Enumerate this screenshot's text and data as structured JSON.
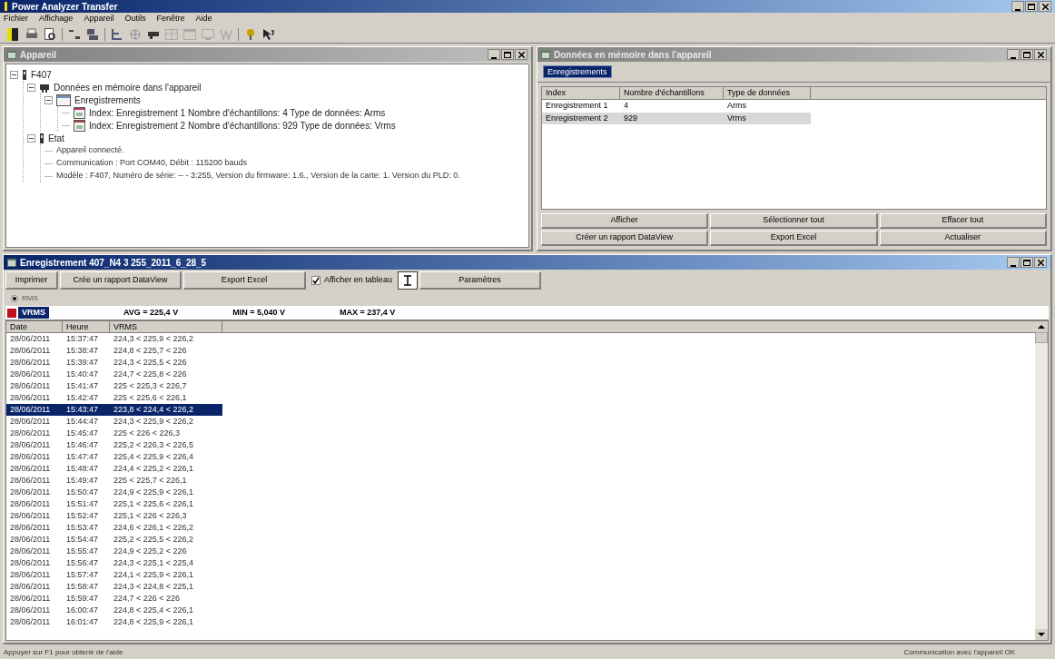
{
  "window": {
    "title": "Power Analyzer Transfer"
  },
  "menu": [
    "Fichier",
    "Affichage",
    "Appareil",
    "Outils",
    "Fenêtre",
    "Aide"
  ],
  "device_pane": {
    "title": "Appareil",
    "tree": [
      {
        "label": "F407",
        "kind": "device",
        "expanded": true,
        "children": [
          {
            "label": "Données en mémoire dans l'appareil",
            "kind": "memory",
            "expanded": true,
            "children": [
              {
                "label": "Enregistrements",
                "kind": "folder",
                "expanded": true,
                "children": [
                  {
                    "label": "Index: Enregistrement 1 Nombre d'échantillons: 4 Type de données: Arms",
                    "kind": "record"
                  },
                  {
                    "label": "Index: Enregistrement 2 Nombre d'échantillons: 929 Type de données: Vrms",
                    "kind": "record"
                  }
                ]
              }
            ]
          },
          {
            "label": "Etat",
            "kind": "device",
            "expanded": true,
            "children": [
              {
                "label": "Appareil connecté.",
                "kind": "info"
              },
              {
                "label": "Communication : Port COM40, Débit : 115200 bauds",
                "kind": "info"
              },
              {
                "label": "Modèle : F407, Numéro de série: -- - 3:255, Version du firmware: 1.6., Version de la carte: 1. Version du PLD: 0.",
                "kind": "info"
              }
            ]
          }
        ]
      }
    ]
  },
  "memory_pane": {
    "title": "Données en mémoire dans l'appareil",
    "tabs": [
      {
        "label": "Enregistrements",
        "selected": true
      }
    ],
    "columns": [
      "Index",
      "Nombre d'échantillons",
      "Type de données"
    ],
    "rows": [
      {
        "cells": [
          "Enregistrement 1",
          "4",
          "Arms"
        ],
        "selected": false
      },
      {
        "cells": [
          "Enregistrement 2",
          "929",
          "Vrms"
        ],
        "selected": true
      }
    ],
    "buttons": [
      "Afficher",
      "Sélectionner tout",
      "Effacer tout",
      "Créer un rapport DataView",
      "Export Excel",
      "Actualiser"
    ]
  },
  "record_pane": {
    "title": "Enregistrement 407_N4 3 255_2011_6_28_5",
    "buttons": [
      "Imprimer",
      "Crée un rapport DataView",
      "Export Excel"
    ],
    "show_table": {
      "label": "Afficher en tableau",
      "checked": true
    },
    "settings_button": "Paramètres",
    "radio": {
      "label": "RMS",
      "selected": true
    },
    "series": {
      "name": "VRMS",
      "color": "#c0101a"
    },
    "stats": [
      "AVG = 225,4 V",
      "MIN = 5,040 V",
      "MAX = 237,4 V"
    ],
    "columns": [
      "Date",
      "Heure",
      "VRMS"
    ],
    "rows": [
      {
        "cells": [
          "28/06/2011",
          "15:37:47",
          "224,3 < 225,9 < 226,2"
        ],
        "selected": false
      },
      {
        "cells": [
          "28/06/2011",
          "15:38:47",
          "224,8 < 225,7 < 226"
        ],
        "selected": false
      },
      {
        "cells": [
          "28/06/2011",
          "15:39:47",
          "224,3 < 225,5 < 226"
        ],
        "selected": false
      },
      {
        "cells": [
          "28/06/2011",
          "15:40:47",
          "224,7 < 225,8 < 226"
        ],
        "selected": false
      },
      {
        "cells": [
          "28/06/2011",
          "15:41:47",
          "225 < 225,3 < 226,7"
        ],
        "selected": false
      },
      {
        "cells": [
          "28/06/2011",
          "15:42:47",
          "225 < 225,6 < 226,1"
        ],
        "selected": false
      },
      {
        "cells": [
          "28/06/2011",
          "15:43:47",
          "223,8 < 224,4 < 226,2"
        ],
        "selected": true
      },
      {
        "cells": [
          "28/06/2011",
          "15:44:47",
          "224,3 < 225,9 < 226,2"
        ],
        "selected": false
      },
      {
        "cells": [
          "28/06/2011",
          "15:45:47",
          "225 < 226 < 226,3"
        ],
        "selected": false
      },
      {
        "cells": [
          "28/06/2011",
          "15:46:47",
          "225,2 < 226,3 < 226,5"
        ],
        "selected": false
      },
      {
        "cells": [
          "28/06/2011",
          "15:47:47",
          "225,4 < 225,9 < 226,4"
        ],
        "selected": false
      },
      {
        "cells": [
          "28/06/2011",
          "15:48:47",
          "224,4 < 225,2 < 226,1"
        ],
        "selected": false
      },
      {
        "cells": [
          "28/06/2011",
          "15:49:47",
          "225 < 225,7 < 226,1"
        ],
        "selected": false
      },
      {
        "cells": [
          "28/06/2011",
          "15:50:47",
          "224,9 < 225,9 < 226,1"
        ],
        "selected": false
      },
      {
        "cells": [
          "28/06/2011",
          "15:51:47",
          "225,1 < 225,6 < 226,1"
        ],
        "selected": false
      },
      {
        "cells": [
          "28/06/2011",
          "15:52:47",
          "225,1 < 226 < 226,3"
        ],
        "selected": false
      },
      {
        "cells": [
          "28/06/2011",
          "15:53:47",
          "224,6 < 226,1 < 226,2"
        ],
        "selected": false
      },
      {
        "cells": [
          "28/06/2011",
          "15:54:47",
          "225,2 < 225,5 < 226,2"
        ],
        "selected": false
      },
      {
        "cells": [
          "28/06/2011",
          "15:55:47",
          "224,9 < 225,2 < 226"
        ],
        "selected": false
      },
      {
        "cells": [
          "28/06/2011",
          "15:56:47",
          "224,3 < 225,1 < 225,4"
        ],
        "selected": false
      },
      {
        "cells": [
          "28/06/2011",
          "15:57:47",
          "224,1 < 225,9 < 226,1"
        ],
        "selected": false
      },
      {
        "cells": [
          "28/06/2011",
          "15:58:47",
          "224,3 < 224,8 < 225,1"
        ],
        "selected": false
      },
      {
        "cells": [
          "28/06/2011",
          "15:59:47",
          "224,7 < 226 < 226"
        ],
        "selected": false
      },
      {
        "cells": [
          "28/06/2011",
          "16:00:47",
          "224,8 < 225,4 < 226,1"
        ],
        "selected": false
      },
      {
        "cells": [
          "28/06/2011",
          "16:01:47",
          "224,8 < 225,9 < 226,1"
        ],
        "selected": false
      }
    ]
  },
  "status_bar": {
    "left": "Appuyer sur F1 pour obtenir de l'aide",
    "right": "Communication avec l'appareil OK"
  }
}
